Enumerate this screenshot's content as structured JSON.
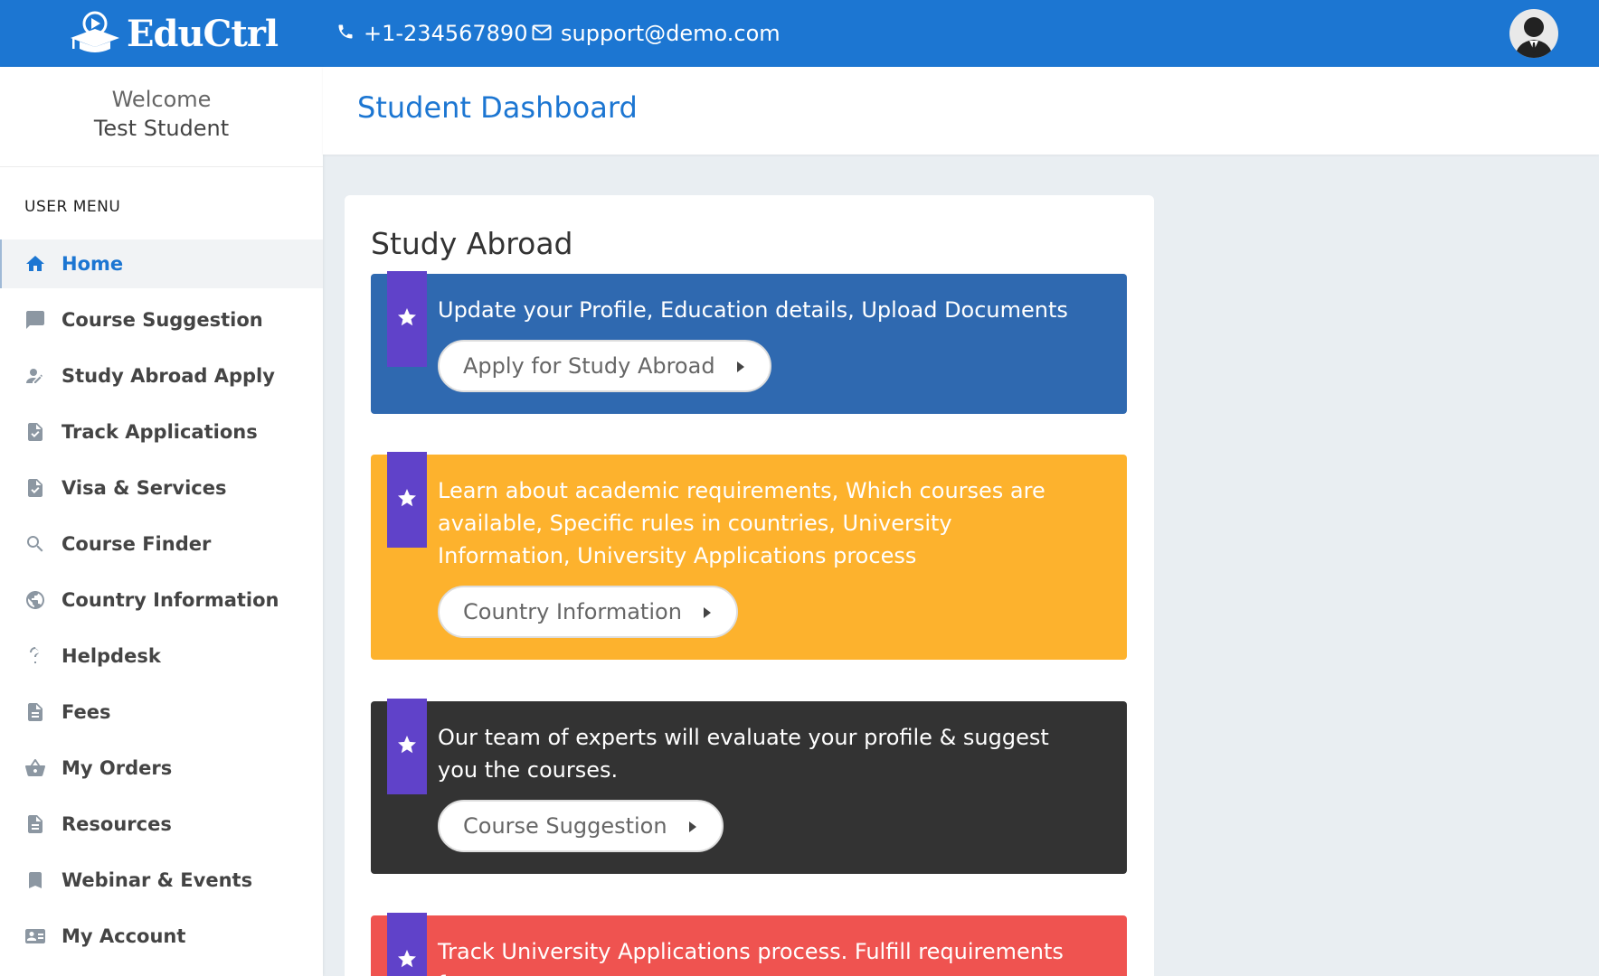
{
  "brand": {
    "name": "EduCtrl",
    "logo_icon": "graduation-cap-play-icon"
  },
  "topbar": {
    "phone": "+1-234567890",
    "phone_icon": "phone-icon",
    "email": "support@demo.com",
    "email_icon": "mail-icon",
    "avatar_icon": "user-avatar-icon"
  },
  "sidebar": {
    "welcome_line1": "Welcome",
    "welcome_line2": "Test Student",
    "menu_title": "USER MENU",
    "items": [
      {
        "label": "Home",
        "icon": "home-icon",
        "active": true
      },
      {
        "label": "Course Suggestion",
        "icon": "chat-icon"
      },
      {
        "label": "Study Abroad Apply",
        "icon": "user-edit-icon"
      },
      {
        "label": "Track Applications",
        "icon": "document-check-icon"
      },
      {
        "label": "Visa & Services",
        "icon": "document-check-icon"
      },
      {
        "label": "Course Finder",
        "icon": "search-icon"
      },
      {
        "label": "Country Information",
        "icon": "globe-icon"
      },
      {
        "label": "Helpdesk",
        "icon": "question-icon"
      },
      {
        "label": "Fees",
        "icon": "document-icon"
      },
      {
        "label": "My Orders",
        "icon": "basket-icon"
      },
      {
        "label": "Resources",
        "icon": "document-icon"
      },
      {
        "label": "Webinar & Events",
        "icon": "bookmark-icon"
      },
      {
        "label": "My Account",
        "icon": "id-card-icon"
      }
    ]
  },
  "header": {
    "title": "Student Dashboard"
  },
  "card": {
    "title": "Study Abroad",
    "panels": [
      {
        "text": "Update your Profile, Education details, Upload Documents",
        "button": "Apply for Study Abroad",
        "color": "#2f69b0"
      },
      {
        "text": "Learn about academic requirements, Which courses are available, Specific rules in countries, University Information, University Applications process",
        "button": "Country Information",
        "color": "#fdb22d"
      },
      {
        "text": "Our team of experts will evaluate your profile & suggest you the courses.",
        "button": "Course Suggestion",
        "color": "#333333"
      },
      {
        "text": "Track University Applications process. Fulfill requirements for",
        "button": "",
        "color": "#ef5350"
      }
    ]
  },
  "colors": {
    "accent": "#1c76d2",
    "ribbon": "#6042c9"
  }
}
